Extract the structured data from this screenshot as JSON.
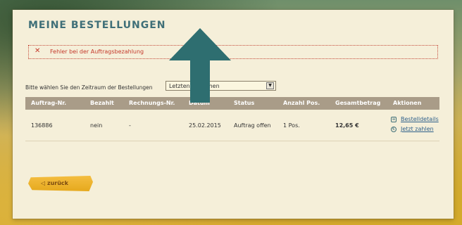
{
  "page_title": "MEINE BESTELLUNGEN",
  "error": {
    "icon": "close-icon",
    "text": "Fehler bei der Auftragsbezahlung"
  },
  "period": {
    "label": "Bitte wählen Sie den Zeitraum der Bestellungen",
    "selected": "Letzten 6 Wochen"
  },
  "table": {
    "headers": [
      "Auftrag-Nr.",
      "Bezahlt",
      "Rechnungs-Nr.",
      "Datum",
      "Status",
      "Anzahl Pos.",
      "Gesamtbetrag",
      "Aktionen"
    ],
    "rows": [
      {
        "order_no": "136886",
        "paid": "nein",
        "invoice_no": "-",
        "date": "25.02.2015",
        "status": "Auftrag offen",
        "positions": "1 Pos.",
        "total": "12,65 €",
        "actions": [
          "Bestelldetails",
          "Jetzt zahlen"
        ]
      }
    ]
  },
  "back_button": "zurück",
  "colors": {
    "accent": "#3f6f78",
    "error": "#c4382a",
    "header_bg": "#a99c88",
    "back_button": "#f2b21f",
    "arrow": "#2e6e70"
  }
}
